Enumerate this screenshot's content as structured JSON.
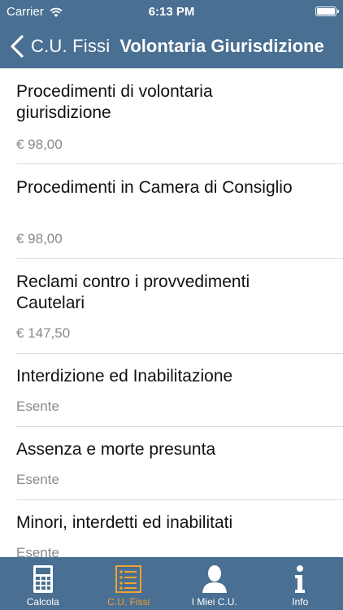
{
  "status_bar": {
    "carrier": "Carrier",
    "time": "6:13 PM"
  },
  "nav": {
    "back_label": "C.U. Fissi",
    "title": "Volontaria Giurisdizione"
  },
  "items": [
    {
      "title": "Procedimenti di volontaria giurisdizione",
      "price": "€ 98,00"
    },
    {
      "title": "Procedimenti in Camera di Consiglio",
      "price": "€ 98,00"
    },
    {
      "title": "Reclami contro i provvedimenti Cautelari",
      "price": "€ 147,50"
    },
    {
      "title": "Interdizione ed Inabilitazione",
      "price": "Esente"
    },
    {
      "title": "Assenza e morte presunta",
      "price": "Esente"
    },
    {
      "title": "Minori, interdetti ed inabilitati",
      "price": "Esente"
    }
  ],
  "tabs": [
    {
      "label": "Calcola",
      "icon": "calculator-icon"
    },
    {
      "label": "C.U. Fissi",
      "icon": "list-icon",
      "active": true
    },
    {
      "label": "I Miei C.U.",
      "icon": "person-icon"
    },
    {
      "label": "Info",
      "icon": "info-icon"
    }
  ],
  "colors": {
    "bar": "#496f92",
    "active_tab": "#f0a330",
    "secondary_text": "#8a8a8a"
  }
}
